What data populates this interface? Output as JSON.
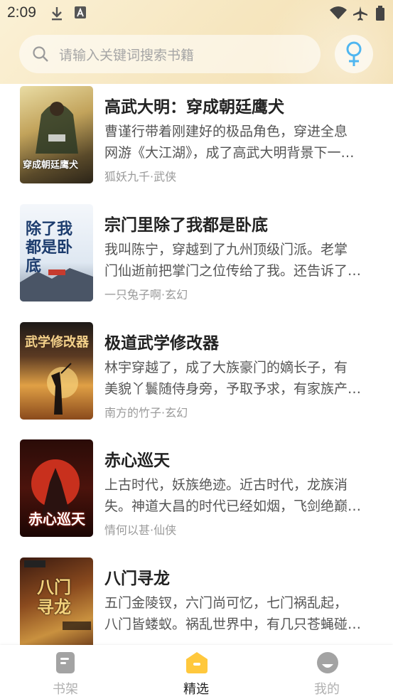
{
  "status_bar": {
    "time": "2:09"
  },
  "search": {
    "placeholder": "请输入关键词搜索书籍"
  },
  "books": [
    {
      "title": "高武大明：穿成朝廷鹰犬",
      "desc1": "曹谨行带着刚建好的极品角色，穿进全息",
      "desc2": "网游《大江湖》，成了高武大明背景下一…",
      "meta": "狐妖九千·武侠",
      "cover_text": "穿成朝廷鹰犬"
    },
    {
      "title": "宗门里除了我都是卧底",
      "desc1": "我叫陈宁，穿越到了九州顶级门派。老掌",
      "desc2": "门仙逝前把掌门之位传给了我。还告诉了…",
      "meta": "一只兔子啊·玄幻",
      "cover_text": "除了我都是卧底"
    },
    {
      "title": "极道武学修改器",
      "desc1": "林宇穿越了，成了大族豪门的嫡长子，有",
      "desc2": "美貌丫鬟随侍身旁，予取予求，有家族产…",
      "meta": "南方的竹子·玄幻",
      "cover_text": "武学修改器"
    },
    {
      "title": "赤心巡天",
      "desc1": "上古时代，妖族绝迹。近古时代，龙族消",
      "desc2": "失。神道大昌的时代已经如烟，飞剑绝巅…",
      "meta": "情何以甚·仙侠",
      "cover_text": "赤心巡天"
    },
    {
      "title": "八门寻龙",
      "desc1": "五门金陵钗，六门尚可忆，七门祸乱起，",
      "desc2": "八门皆蝼蚁。祸乱世界中，有几只苍蝇碰…",
      "meta": "",
      "cover_text": "八门寻龙"
    }
  ],
  "nav": {
    "tabs": [
      {
        "label": "书架",
        "icon": "bookshelf-icon"
      },
      {
        "label": "精选",
        "icon": "featured-icon"
      },
      {
        "label": "我的",
        "icon": "profile-icon"
      }
    ],
    "active_color": "#222222",
    "inactive_color": "#b0b0b0",
    "accent": "#ffc83d"
  },
  "colors": {
    "gender_icon": "#4fb6f0"
  }
}
